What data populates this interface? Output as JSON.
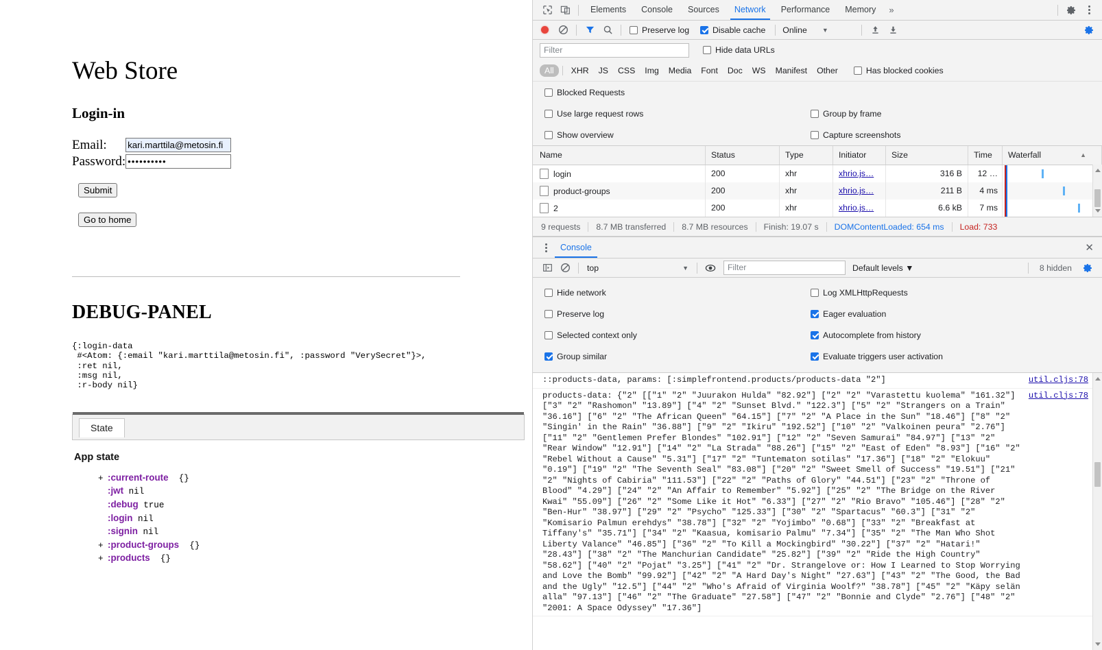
{
  "page": {
    "title": "Web Store",
    "section_heading": "Login-in",
    "email_label": "Email:",
    "password_label": "Password:",
    "email_value": "kari.marttila@metosin.fi",
    "password_value": "••••••••••",
    "email_placeholder": "",
    "password_placeholder": "",
    "submit_label": "Submit",
    "home_label": "Go to home",
    "debug_heading": "DEBUG-PANEL",
    "debug_edn": "{:login-data\n #<Atom: {:email \"kari.marttila@metosin.fi\", :password \"VerySecret\"}>,\n :ret nil,\n :msg nil,\n :r-body nil}",
    "state_tab": "State",
    "app_state_title": "App state",
    "state_tree": [
      {
        "expander": "+",
        "key": ":current-route",
        "value": "{}"
      },
      {
        "expander": "",
        "key": ":jwt",
        "value": "nil"
      },
      {
        "expander": "",
        "key": ":debug",
        "value": "true"
      },
      {
        "expander": "",
        "key": ":login",
        "value": "nil"
      },
      {
        "expander": "",
        "key": ":signin",
        "value": "nil"
      },
      {
        "expander": "+",
        "key": ":product-groups",
        "value": "{}"
      },
      {
        "expander": "+",
        "key": ":products",
        "value": "{}"
      }
    ]
  },
  "devtools": {
    "tabs": [
      {
        "label": "Elements",
        "selected": false
      },
      {
        "label": "Console",
        "selected": false
      },
      {
        "label": "Sources",
        "selected": false
      },
      {
        "label": "Network",
        "selected": true
      },
      {
        "label": "Performance",
        "selected": false
      },
      {
        "label": "Memory",
        "selected": false
      }
    ],
    "more_tabs_label": "»",
    "network": {
      "toolbar": {
        "preserve_log_label": "Preserve log",
        "preserve_log_checked": false,
        "disable_cache_label": "Disable cache",
        "disable_cache_checked": true,
        "throttling_value": "Online",
        "dropdown_caret": "▼"
      },
      "filter_placeholder": "Filter",
      "filter_value": "",
      "hide_data_urls_label": "Hide data URLs",
      "hide_data_urls_checked": false,
      "types": [
        "All",
        "XHR",
        "JS",
        "CSS",
        "Img",
        "Media",
        "Font",
        "Doc",
        "WS",
        "Manifest",
        "Other"
      ],
      "type_selected": "All",
      "has_blocked_cookies_label": "Has blocked cookies",
      "has_blocked_cookies_checked": false,
      "blocked_requests_label": "Blocked Requests",
      "blocked_requests_checked": false,
      "options": [
        {
          "label": "Use large request rows",
          "checked": false
        },
        {
          "label": "Group by frame",
          "checked": false
        },
        {
          "label": "Show overview",
          "checked": false
        },
        {
          "label": "Capture screenshots",
          "checked": false
        }
      ],
      "columns": [
        "Name",
        "Status",
        "Type",
        "Initiator",
        "Size",
        "Time",
        "Waterfall"
      ],
      "rows": [
        {
          "name": "login",
          "status": "200",
          "type": "xhr",
          "initiator": "xhrio.js…",
          "size": "316 B",
          "time": "12 …"
        },
        {
          "name": "product-groups",
          "status": "200",
          "type": "xhr",
          "initiator": "xhrio.js…",
          "size": "211 B",
          "time": "4 ms"
        },
        {
          "name": "2",
          "status": "200",
          "type": "xhr",
          "initiator": "xhrio.js…",
          "size": "6.6 kB",
          "time": "7 ms"
        }
      ],
      "summary": {
        "requests": "9 requests",
        "transferred": "8.7 MB transferred",
        "resources": "8.7 MB resources",
        "finish": "Finish: 19.07 s",
        "dcl": "DOMContentLoaded: 654 ms",
        "load": "Load: 733"
      }
    },
    "console": {
      "tab_label": "Console",
      "context": "top",
      "context_caret": "▼",
      "filter_placeholder": "Filter",
      "filter_value": "",
      "levels_label": "Default levels ▼",
      "hidden_label": "8 hidden",
      "settings": [
        {
          "label": "Hide network",
          "checked": false
        },
        {
          "label": "Log XMLHttpRequests",
          "checked": false
        },
        {
          "label": "Preserve log",
          "checked": false
        },
        {
          "label": "Eager evaluation",
          "checked": true
        },
        {
          "label": "Selected context only",
          "checked": false
        },
        {
          "label": "Autocomplete from history",
          "checked": true
        },
        {
          "label": "Group similar",
          "checked": true
        },
        {
          "label": "Evaluate triggers user activation",
          "checked": true
        }
      ],
      "entries": [
        {
          "text": "::products-data, params: [:simplefrontend.products/products-data \"2\"]",
          "source": "util.cljs:78"
        },
        {
          "text": "products-data: {\"2\" [[\"1\" \"2\" \"Juurakon Hulda\" \"82.92\"] [\"2\" \"2\" \"Varastettu kuolema\" \"161.32\"] [\"3\" \"2\" \"Rashomon\" \"13.89\"] [\"4\" \"2\" \"Sunset Blvd.\" \"122.3\"] [\"5\" \"2\" \"Strangers on a Train\" \"36.16\"] [\"6\" \"2\" \"The African Queen\" \"64.15\"] [\"7\" \"2\" \"A Place in the Sun\" \"18.46\"] [\"8\" \"2\" \"Singin' in the Rain\" \"36.88\"] [\"9\" \"2\" \"Ikiru\" \"192.52\"] [\"10\" \"2\" \"Valkoinen peura\" \"2.76\"] [\"11\" \"2\" \"Gentlemen Prefer Blondes\" \"102.91\"] [\"12\" \"2\" \"Seven Samurai\" \"84.97\"] [\"13\" \"2\" \"Rear Window\" \"12.91\"] [\"14\" \"2\" \"La Strada\" \"88.26\"] [\"15\" \"2\" \"East of Eden\" \"8.93\"] [\"16\" \"2\" \"Rebel Without a Cause\" \"5.31\"] [\"17\" \"2\" \"Tuntematon sotilas\" \"17.36\"] [\"18\" \"2\" \"Elokuu\" \"0.19\"] [\"19\" \"2\" \"The Seventh Seal\" \"83.08\"] [\"20\" \"2\" \"Sweet Smell of Success\" \"19.51\"] [\"21\" \"2\" \"Nights of Cabiria\" \"111.53\"] [\"22\" \"2\" \"Paths of Glory\" \"44.51\"] [\"23\" \"2\" \"Throne of Blood\" \"4.29\"] [\"24\" \"2\" \"An Affair to Remember\" \"5.92\"] [\"25\" \"2\" \"The Bridge on the River Kwai\" \"55.09\"] [\"26\" \"2\" \"Some Like it Hot\" \"6.33\"] [\"27\" \"2\" \"Rio Bravo\" \"105.46\"] [\"28\" \"2\" \"Ben-Hur\" \"38.97\"] [\"29\" \"2\" \"Psycho\" \"125.33\"] [\"30\" \"2\" \"Spartacus\" \"60.3\"] [\"31\" \"2\" \"Komisario Palmun erehdys\" \"38.78\"] [\"32\" \"2\" \"Yojimbo\" \"0.68\"] [\"33\" \"2\" \"Breakfast at Tiffany's\" \"35.71\"] [\"34\" \"2\" \"Kaasua, komisario Palmu\" \"7.34\"] [\"35\" \"2\" \"The Man Who Shot Liberty Valance\" \"46.85\"] [\"36\" \"2\" \"To Kill a Mockingbird\" \"30.22\"] [\"37\" \"2\" \"Hatari!\" \"28.43\"] [\"38\" \"2\" \"The Manchurian Candidate\" \"25.82\"] [\"39\" \"2\" \"Ride the High Country\" \"58.62\"] [\"40\" \"2\" \"Pojat\" \"3.25\"] [\"41\" \"2\" \"Dr. Strangelove or: How I Learned to Stop Worrying and Love the Bomb\" \"99.92\"] [\"42\" \"2\" \"A Hard Day's Night\" \"27.63\"] [\"43\" \"2\" \"The Good, the Bad and the Ugly\" \"12.5\"] [\"44\" \"2\" \"Who's Afraid of Virginia Woolf?\" \"38.78\"] [\"45\" \"2\" \"Käpy selän alla\" \"97.13\"] [\"46\" \"2\" \"The Graduate\" \"27.58\"] [\"47\" \"2\" \"Bonnie and Clyde\" \"2.76\"] [\"48\" \"2\" \"2001: A Space Odyssey\" \"17.36\"]",
          "source": "util.cljs:78"
        }
      ]
    }
  }
}
